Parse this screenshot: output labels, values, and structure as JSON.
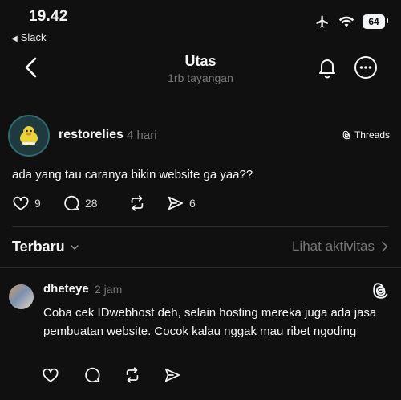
{
  "status_bar": {
    "time": "19.42",
    "back_app": "Slack",
    "battery": "64"
  },
  "header": {
    "title": "Utas",
    "views": "1rb tayangan"
  },
  "post": {
    "author": "restorelies",
    "age": "4 hari",
    "source_label": "Threads",
    "text": "ada yang tau caranya bikin website ga yaa??",
    "likes": "9",
    "replies": "28",
    "shares": "6"
  },
  "thread_controls": {
    "sort_label": "Terbaru",
    "activity_link": "Lihat aktivitas"
  },
  "reply": {
    "author": "dheteye",
    "age": "2 jam",
    "text": "Coba cek IDwebhost deh, selain hosting mereka juga ada jasa pembuatan website. Cocok kalau nggak mau ribet ngoding"
  },
  "colors": {
    "background": "#101010",
    "text": "#f3f5f7",
    "muted": "#777777",
    "divider": "#2a2a2a"
  }
}
